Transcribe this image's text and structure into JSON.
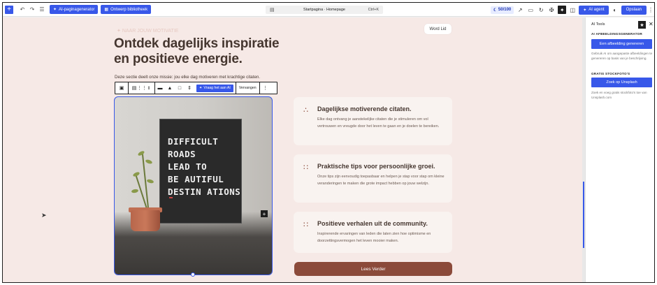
{
  "toolbar": {
    "add_label": "+",
    "ai_generator_label": "AI-paginagenerator",
    "design_library_label": "Ontwerp bibliotheek",
    "command": {
      "title": "Startpagina · Homepage",
      "shortcut": "Ctrl+K"
    },
    "score": "50/100",
    "ai_agent_label": "AI agent",
    "save_label": "Opslaan"
  },
  "canvas": {
    "ghost_logo": "NAAR JOUW MOTIVATIE",
    "member_button": "Word Lid",
    "hero_title": "Ontdek dagelijks inspiratie en positieve energie.",
    "hero_description": "Deze sectie deelt onze missie: jou elke dag motiveren met krachtige citaten.",
    "block_toolbar": {
      "ask_ai_label": "Vraag het aan AI",
      "replace_label": "Vervangen"
    },
    "letterboard_lines": [
      "DIFFICULT",
      "ROADS",
      "LEAD TO",
      "BE AUTIFUL",
      "DESTIN ATIONS"
    ],
    "cards": [
      {
        "title": "Dagelijkse motiverende citaten.",
        "text": "Elke dag ontvang je aanstekelijke citaten die je stimuleren om vol vertrouwen en vreugde door het leven te gaan en je doelen te bereiken."
      },
      {
        "title": "Praktische tips voor persoonlijke groei.",
        "text": "Onze tips zijn eenvoudig toepasbaar en helpen je stap voor stap om kleine veranderingen te maken die grote impact hebben op jouw welzijn."
      },
      {
        "title": "Positieve verhalen uit de community.",
        "text": "Inspirerende ervaringen van leden die laten zien hoe optimisme en doorzettingsvermogen het leven mooier maken."
      }
    ],
    "cta_label": "Lees Verder"
  },
  "panel": {
    "title": "AI Tools",
    "sections": [
      {
        "label": "AI AFBEELDINGSGENERATOR",
        "button": "Een afbeelding genereren",
        "help": "Gebruik AI om aangepaste afbeeldingen te genereren op basis van je beschrijving."
      },
      {
        "label": "GRATIS STOCKFOTO'S",
        "button": "Zoek op Unsplash",
        "help": "Zoek en voeg gratis stockfoto's toe van Unsplash.com"
      }
    ]
  },
  "icons": {
    "undo": "undo-icon",
    "redo": "redo-icon",
    "list_view": "list-view-icon",
    "moon": "contrast-icon"
  },
  "colors": {
    "accent": "#3858e9",
    "brand_brown": "#8b4a3a",
    "canvas_bg": "#f6e9e6",
    "card_bg": "#f9f3f0"
  }
}
